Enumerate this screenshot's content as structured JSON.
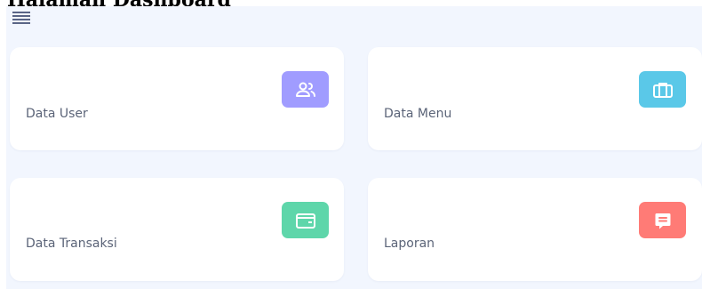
{
  "page": {
    "title": "Halaman Dashboard"
  },
  "header": {
    "menu_icon": "hamburger-menu-icon"
  },
  "cards": [
    {
      "label": "Data User",
      "icon": "users-icon",
      "color": "#a09cff"
    },
    {
      "label": "Data Menu",
      "icon": "briefcase-icon",
      "color": "#5ac8e8"
    },
    {
      "label": "Data Transaksi",
      "icon": "wallet-icon",
      "color": "#5ed6aa"
    },
    {
      "label": "Laporan",
      "icon": "message-square-icon",
      "color": "#ff7b76"
    }
  ]
}
